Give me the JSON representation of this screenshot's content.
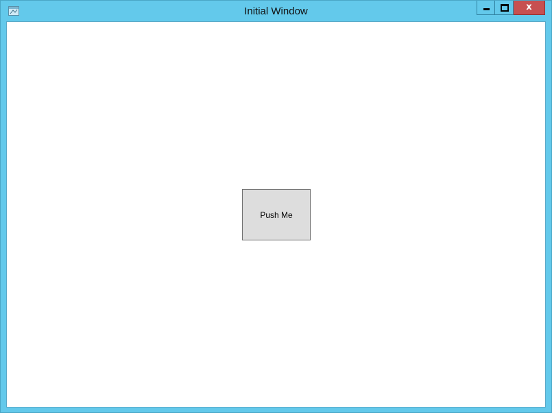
{
  "window": {
    "title": "Initial Window",
    "close_glyph": "x",
    "frame_color": "#63c9eb",
    "close_color": "#c75050"
  },
  "main": {
    "button_label": "Push Me"
  },
  "icons": [
    "app-window-icon",
    "minimize-icon",
    "maximize-icon",
    "close-icon"
  ]
}
